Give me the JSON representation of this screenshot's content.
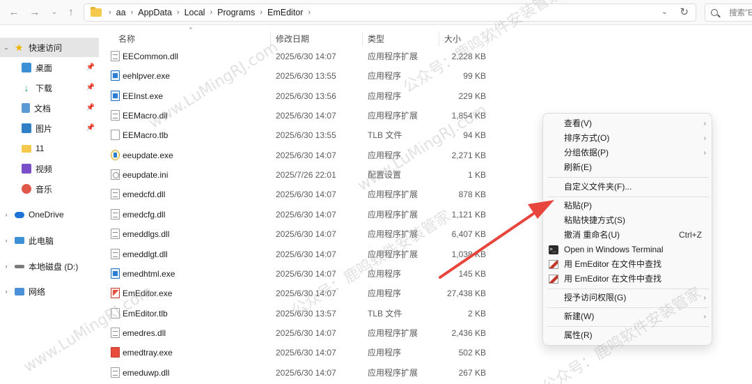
{
  "address_bar": {
    "crumbs": [
      "aa",
      "AppData",
      "Local",
      "Programs",
      "EmEditor"
    ],
    "search_placeholder": "搜索\"E"
  },
  "sidebar": {
    "items": [
      {
        "label": "快速访问",
        "icon": "star-icon"
      },
      {
        "label": "桌面",
        "icon": "desktop-icon"
      },
      {
        "label": "下载",
        "icon": "download-icon"
      },
      {
        "label": "文档",
        "icon": "documents-icon"
      },
      {
        "label": "图片",
        "icon": "pictures-icon"
      },
      {
        "label": "11",
        "icon": "folder-icon"
      },
      {
        "label": "视频",
        "icon": "video-icon"
      },
      {
        "label": "音乐",
        "icon": "music-icon"
      },
      {
        "label": "OneDrive",
        "icon": "cloud-icon"
      },
      {
        "label": "此电脑",
        "icon": "computer-icon"
      },
      {
        "label": "本地磁盘 (D:)",
        "icon": "drive-icon"
      },
      {
        "label": "网络",
        "icon": "network-icon"
      }
    ]
  },
  "columns": {
    "name": "名称",
    "date": "修改日期",
    "type": "类型",
    "size": "大小"
  },
  "files": [
    {
      "name": "EECommon.dll",
      "date": "2025/6/30 14:07",
      "type": "应用程序扩展",
      "size": "2,228 KB",
      "icon": "dll"
    },
    {
      "name": "eehlpver.exe",
      "date": "2025/6/30 13:55",
      "type": "应用程序",
      "size": "99 KB",
      "icon": "exe"
    },
    {
      "name": "EEInst.exe",
      "date": "2025/6/30 13:56",
      "type": "应用程序",
      "size": "229 KB",
      "icon": "exe"
    },
    {
      "name": "EEMacro.dll",
      "date": "2025/6/30 14:07",
      "type": "应用程序扩展",
      "size": "1,854 KB",
      "icon": "dll"
    },
    {
      "name": "EEMacro.tlb",
      "date": "2025/6/30 13:55",
      "type": "TLB 文件",
      "size": "94 KB",
      "icon": "file"
    },
    {
      "name": "eeupdate.exe",
      "date": "2025/6/30 14:07",
      "type": "应用程序",
      "size": "2,271 KB",
      "icon": "upd"
    },
    {
      "name": "eeupdate.ini",
      "date": "2025/7/26 22:01",
      "type": "配置设置",
      "size": "1 KB",
      "icon": "ini"
    },
    {
      "name": "emedcfd.dll",
      "date": "2025/6/30 14:07",
      "type": "应用程序扩展",
      "size": "878 KB",
      "icon": "dll"
    },
    {
      "name": "emedcfg.dll",
      "date": "2025/6/30 14:07",
      "type": "应用程序扩展",
      "size": "1,121 KB",
      "icon": "dll"
    },
    {
      "name": "emeddlgs.dll",
      "date": "2025/6/30 14:07",
      "type": "应用程序扩展",
      "size": "6,407 KB",
      "icon": "dll"
    },
    {
      "name": "emeddlgt.dll",
      "date": "2025/6/30 14:07",
      "type": "应用程序扩展",
      "size": "1,038 KB",
      "icon": "dll"
    },
    {
      "name": "emedhtml.exe",
      "date": "2025/6/30 14:07",
      "type": "应用程序",
      "size": "145 KB",
      "icon": "exe"
    },
    {
      "name": "EmEditor.exe",
      "date": "2025/6/30 14:07",
      "type": "应用程序",
      "size": "27,438 KB",
      "icon": "em"
    },
    {
      "name": "EmEditor.tlb",
      "date": "2025/6/30 13:57",
      "type": "TLB 文件",
      "size": "2 KB",
      "icon": "file"
    },
    {
      "name": "emedres.dll",
      "date": "2025/6/30 14:07",
      "type": "应用程序扩展",
      "size": "2,436 KB",
      "icon": "dll"
    },
    {
      "name": "emedtray.exe",
      "date": "2025/6/30 14:07",
      "type": "应用程序",
      "size": "502 KB",
      "icon": "tray"
    },
    {
      "name": "emeduwp.dll",
      "date": "2025/6/30 14:07",
      "type": "应用程序扩展",
      "size": "267 KB",
      "icon": "dll"
    }
  ],
  "context_menu": {
    "view": "查看(V)",
    "sort": "排序方式(O)",
    "group": "分组依据(P)",
    "refresh": "刷新(E)",
    "customize": "自定义文件夹(F)...",
    "paste": "粘贴(P)",
    "paste_shortcut": "粘贴快捷方式(S)",
    "undo_rename": "撤消 重命名(U)",
    "undo_shortcut": "Ctrl+Z",
    "open_terminal": "Open in Windows Terminal",
    "emeditor_find_1": "用 EmEditor 在文件中查找",
    "emeditor_find_2": "用 EmEditor 在文件中查找",
    "grant_access": "授予访问权限(G)",
    "new": "新建(W)",
    "properties": "属性(R)"
  },
  "watermark": {
    "site": "www.LuMingRJ.com",
    "account": "公众号：鹿鸣软件安装管家"
  },
  "colors": {
    "arrow": "#e8453c",
    "accent": "#0067c0"
  }
}
